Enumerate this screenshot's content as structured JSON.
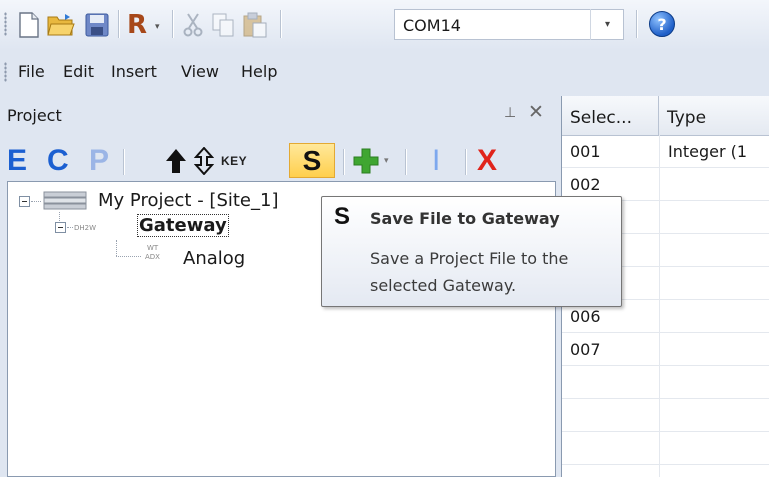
{
  "toolbar": {
    "icons": [
      "new-file-icon",
      "open-folder-icon",
      "save-icon",
      "r-icon",
      "cut-icon",
      "copy-icon",
      "paste-icon",
      "help-icon"
    ],
    "r_label": "R",
    "port_value": "COM14",
    "help_label": "?"
  },
  "menu": {
    "items": [
      "File",
      "Edit",
      "Insert",
      "View",
      "Help"
    ]
  },
  "project_panel": {
    "title": "Project",
    "tools": {
      "e_label": "E",
      "c_label": "C",
      "p_label": "P",
      "key_label": "KEY",
      "s_label": "S",
      "i_label": "I",
      "x_label": "X"
    },
    "tree": {
      "root": "My Project - [Site_1]",
      "gateway_tag": "DH2W",
      "gateway": "Gateway",
      "child_tag_top": "WT",
      "child_tag_bottom": "ADX",
      "child": "Analog"
    }
  },
  "tooltip": {
    "icon_label": "S",
    "title": "Save File to Gateway",
    "body": "Save a Project File to the selected Gateway."
  },
  "grid": {
    "columns": [
      "Selec...",
      "Type"
    ],
    "rows": [
      {
        "select": "001",
        "type": "Integer (1"
      },
      {
        "select": "002",
        "type": ""
      },
      {
        "select": "",
        "type": ""
      },
      {
        "select": "",
        "type": ""
      },
      {
        "select": "",
        "type": ""
      },
      {
        "select": "006",
        "type": ""
      },
      {
        "select": "007",
        "type": ""
      },
      {
        "select": "",
        "type": ""
      },
      {
        "select": "",
        "type": ""
      },
      {
        "select": "",
        "type": ""
      }
    ]
  },
  "colors": {
    "accent_blue": "#1b5fd1",
    "disabled_blue": "#9bb5e6",
    "delete_red": "#e0241b",
    "add_green": "#3fa631",
    "highlight_yellow": "#ffd65a"
  }
}
